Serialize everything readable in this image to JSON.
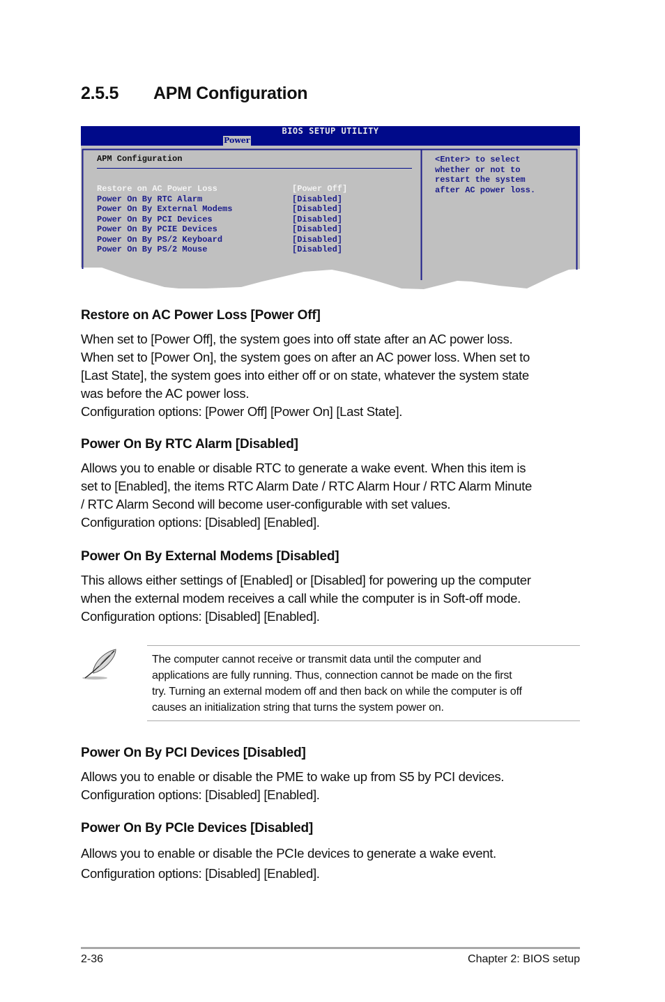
{
  "section": {
    "number": "2.5.5",
    "title": "APM Configuration"
  },
  "bios": {
    "utility_title": "BIOS SETUP UTILITY",
    "active_tab": "Power",
    "panel_heading": "APM Configuration",
    "colors": {
      "header_bg": "#000a8a",
      "panel_bg": "#c0c0c0",
      "item_text": "#1b1d8a",
      "selected_text": "#f4f4f4"
    },
    "items": [
      {
        "label": "Restore on AC Power Loss",
        "value": "[Power Off]",
        "selected": true
      },
      {
        "label": "Power On By RTC Alarm",
        "value": "[Disabled]",
        "selected": false
      },
      {
        "label": "Power On By External Modems",
        "value": "[Disabled]",
        "selected": false
      },
      {
        "label": "Power On By PCI Devices",
        "value": "[Disabled]",
        "selected": false
      },
      {
        "label": "Power On By PCIE Devices",
        "value": "[Disabled]",
        "selected": false
      },
      {
        "label": "Power On By PS/2 Keyboard",
        "value": "[Disabled]",
        "selected": false
      },
      {
        "label": "Power On By PS/2 Mouse",
        "value": "[Disabled]",
        "selected": false
      }
    ],
    "help_lines": [
      "<Enter> to select",
      "whether or not to",
      "restart the system",
      "after AC power loss."
    ]
  },
  "sections": [
    {
      "heading": "Restore on AC Power Loss [Power Off]",
      "lines": [
        "When set to [Power Off], the system goes into off state after an AC power loss.",
        "When set to [Power On], the system goes on after an AC power loss. When set to",
        "[Last State], the system goes into either off or on state, whatever the system state",
        "was before the AC power loss.",
        "Configuration options: [Power Off] [Power On] [Last State]."
      ]
    },
    {
      "heading": "Power On By RTC Alarm [Disabled]",
      "lines": [
        "Allows you to enable or disable RTC to generate a wake event. When this item is",
        "set to [Enabled], the items RTC Alarm Date / RTC Alarm Hour / RTC Alarm Minute",
        "/ RTC Alarm Second will become user-configurable with set values.",
        "Configuration options: [Disabled] [Enabled]."
      ]
    },
    {
      "heading": "Power On By External Modems [Disabled]",
      "lines": [
        "This allows either settings of [Enabled] or [Disabled] for powering up the computer",
        "when the external modem receives a call while the computer is in Soft-off mode.",
        "Configuration options: [Disabled] [Enabled]."
      ]
    },
    {
      "heading": "Power On By PCI Devices [Disabled]",
      "lines": [
        "Allows you to enable or disable the PME to wake up from S5 by PCI devices.",
        "Configuration options: [Disabled] [Enabled]."
      ]
    },
    {
      "heading": "Power On By PCIe Devices [Disabled]",
      "lines": [
        "Allows you to enable or disable the PCIe devices to generate a wake event.",
        "Configuration options: [Disabled] [Enabled]."
      ]
    }
  ],
  "note": {
    "icon": "feather-quill-icon",
    "lines": [
      "The computer cannot receive or transmit data until the computer and",
      "applications are fully running. Thus, connection cannot be made on the first",
      "try. Turning an external modem off and then back on while the computer is off",
      "causes an initialization string that turns the system power on."
    ]
  },
  "footer": {
    "page_number": "2-36",
    "chapter": "Chapter 2: BIOS setup"
  }
}
